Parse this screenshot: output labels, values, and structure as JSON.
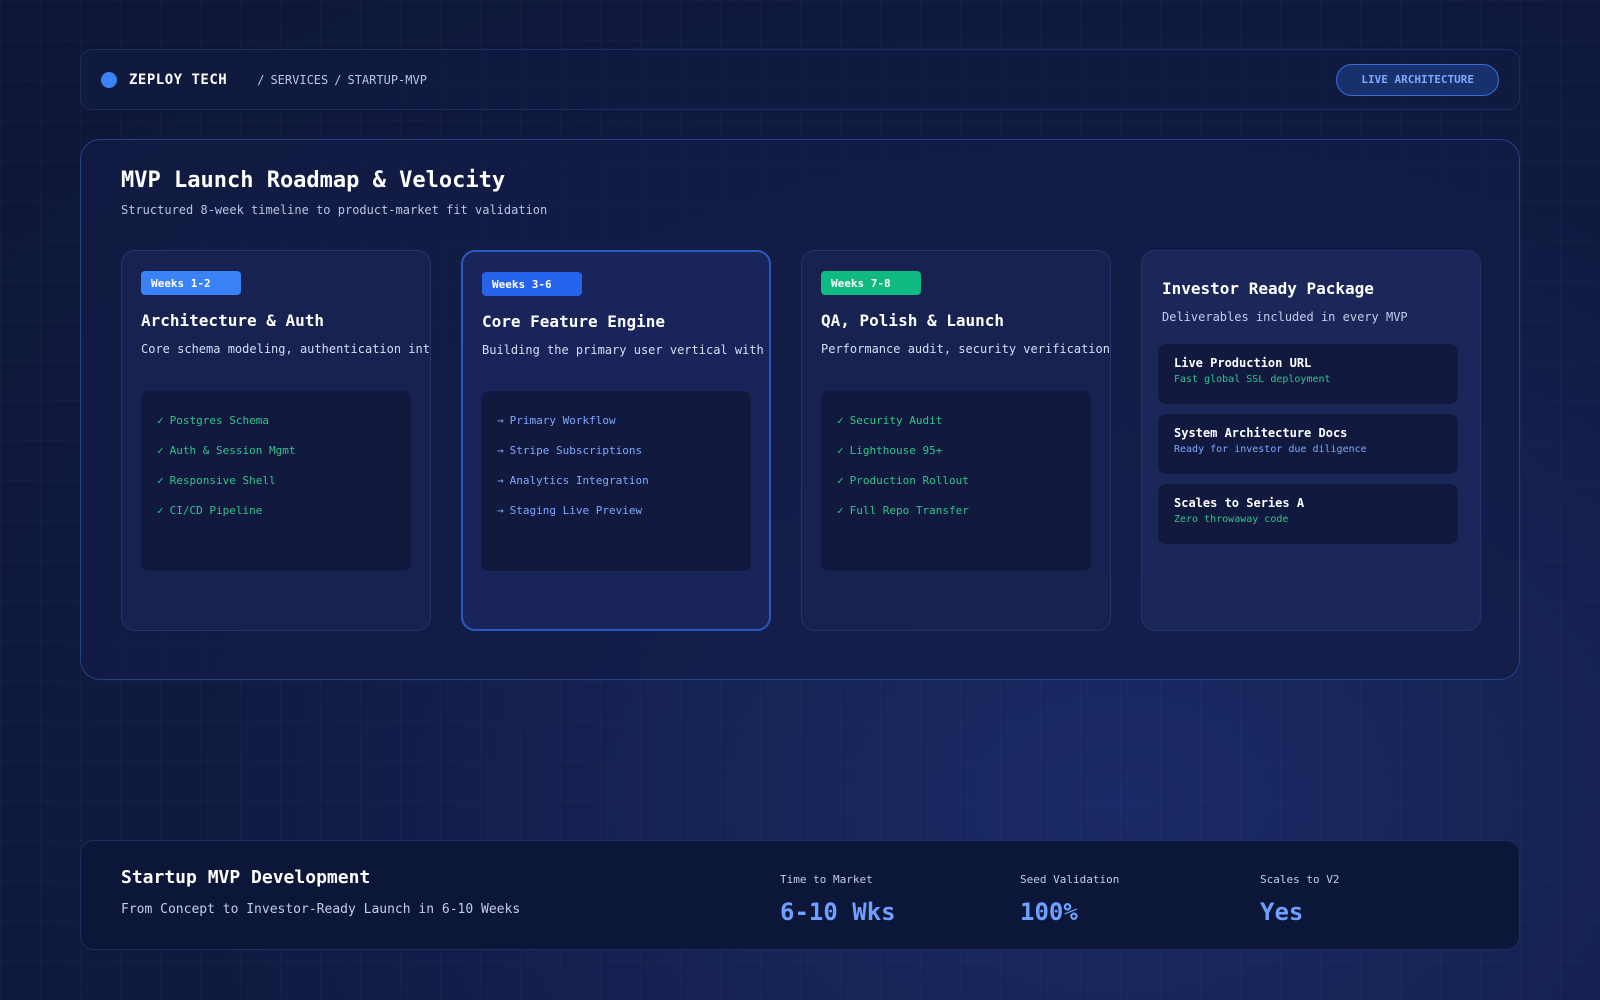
{
  "header": {
    "brand": "ZEPLOY TECH",
    "breadcrumb": [
      "/",
      "SERVICES",
      "/",
      "STARTUP-MVP"
    ],
    "live_button": "LIVE ARCHITECTURE",
    "colors": {
      "accent": "#3b82f6"
    }
  },
  "roadmap": {
    "title": "MVP Launch Roadmap & Velocity",
    "subtitle": "Structured 8-week timeline to product-market fit validation",
    "phases": [
      {
        "badge": "Weeks 1-2",
        "badge_color": "#3b82f6",
        "title": "Architecture & Auth",
        "description": "Core schema modeling, authentication integration",
        "marker": "✓",
        "items": [
          "Postgres Schema",
          "Auth & Session Mgmt",
          "Responsive Shell",
          "CI/CD Pipeline"
        ]
      },
      {
        "badge": "Weeks 3-6",
        "badge_color": "#2563eb",
        "title": "Core Feature Engine",
        "description": "Building the primary user vertical with bi-weekly",
        "marker": "→",
        "items": [
          "Primary Workflow",
          "Stripe Subscriptions",
          "Analytics Integration",
          "Staging Live Preview"
        ]
      },
      {
        "badge": "Weeks 7-8",
        "badge_color": "#10b981",
        "title": "QA, Polish & Launch",
        "description": "Performance audit, security verification, custom",
        "marker": "✓",
        "items": [
          "Security Audit",
          "Lighthouse 95+",
          "Production Rollout",
          "Full Repo Transfer"
        ]
      }
    ],
    "package": {
      "title": "Investor Ready Package",
      "subtitle": "Deliverables included in every MVP",
      "deliverables": [
        {
          "title": "Live Production URL",
          "sub": "Fast global SSL deployment"
        },
        {
          "title": "System Architecture Docs",
          "sub": "Ready for investor due diligence"
        },
        {
          "title": "Scales to Series A",
          "sub": "Zero throwaway code"
        }
      ]
    }
  },
  "footer": {
    "title": "Startup MVP Development",
    "subtitle": "From Concept to Investor-Ready Launch in 6-10 Weeks",
    "metrics": [
      {
        "label": "Time to Market",
        "value": "6-10 Wks"
      },
      {
        "label": "Seed Validation",
        "value": "100%"
      },
      {
        "label": "Scales to V2",
        "value": "Yes"
      }
    ]
  }
}
